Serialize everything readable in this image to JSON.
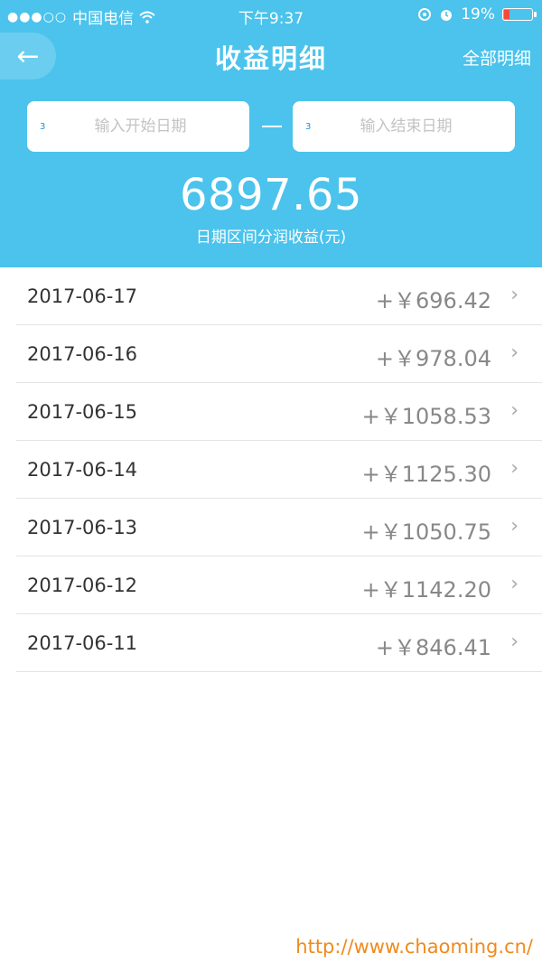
{
  "status_bar": {
    "signal": "●●●○○",
    "carrier": "中国电信",
    "wifi_icon": "wifi-icon",
    "time": "下午9:37",
    "battery_percent": "19%",
    "battery_level": 0.19
  },
  "nav": {
    "back_icon": "arrow-left-icon",
    "back_glyph": "←",
    "title": "收益明细",
    "all_detail": "全部明细"
  },
  "filters": {
    "start_placeholder": "输入开始日期",
    "end_placeholder": "输入结束日期",
    "calendar_icon": "calendar-icon"
  },
  "summary": {
    "total": "6897.65",
    "label": "日期区间分润收益(元)"
  },
  "records": [
    {
      "date": "2017-06-17",
      "amount": "+￥696.42"
    },
    {
      "date": "2017-06-16",
      "amount": "+￥978.04"
    },
    {
      "date": "2017-06-15",
      "amount": "+￥1058.53"
    },
    {
      "date": "2017-06-14",
      "amount": "+￥1125.30"
    },
    {
      "date": "2017-06-13",
      "amount": "+￥1050.75"
    },
    {
      "date": "2017-06-12",
      "amount": "+￥1142.20"
    },
    {
      "date": "2017-06-11",
      "amount": "+￥846.41"
    }
  ],
  "chevron": "›",
  "watermark": "http://www.chaoming.cn/",
  "colors": {
    "header_bg": "#4bc3ec",
    "calendar": "#1f8fdc",
    "watermark": "#f08a1c",
    "battery_low": "#f34b3b"
  }
}
